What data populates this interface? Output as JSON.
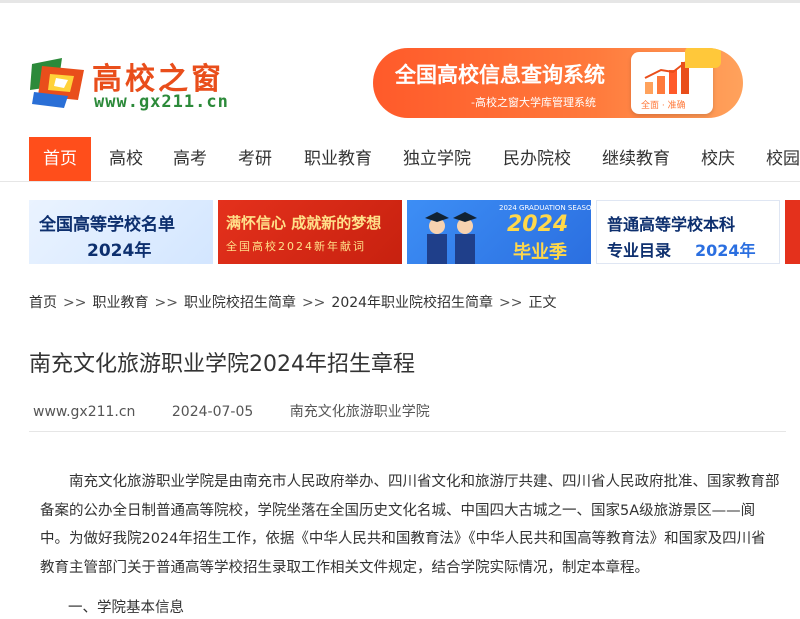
{
  "header": {
    "logo_title": "高校之窗",
    "logo_url": "www.gx211.cn",
    "banner_title": "全国高校信息查询系统",
    "banner_sub": "-高校之窗大学库管理系统",
    "banner_card_text": "全面 · 准确"
  },
  "nav": {
    "items": [
      "首页",
      "高校",
      "高考",
      "考研",
      "职业教育",
      "独立学院",
      "民办院校",
      "继续教育",
      "校庆",
      "校园"
    ]
  },
  "promos": {
    "t1_line1": "全国高等学校名单",
    "t1_line2": "2024年",
    "t2_line1": "满怀信心 成就新的梦想",
    "t2_line2": "全国高校2024新年献词",
    "t3_tag": "2024 GRADUATION SEASON",
    "t3_year": "2024",
    "t3_word": "毕业季",
    "t4_line1": "普通高等学校本科",
    "t4_line2a": "专业目录",
    "t4_line2b": "2024年"
  },
  "breadcrumb": {
    "items": [
      "首页",
      "职业教育",
      "职业院校招生简章",
      "2024年职业院校招生简章",
      "正文"
    ],
    "sep": ">>"
  },
  "article": {
    "title": "南充文化旅游职业学院2024年招生章程",
    "source": "www.gx211.cn",
    "date": "2024-07-05",
    "author": "南充文化旅游职业学院",
    "paragraph": "南充文化旅游职业学院是由南充市人民政府举办、四川省文化和旅游厅共建、四川省人民政府批准、国家教育部备案的公办全日制普通高等院校，学院坐落在全国历史文化名城、中国四大古城之一、国家5A级旅游景区——阆中。为做好我院2024年招生工作，依据《中华人民共和国教育法》《中华人民共和国高等教育法》和国家及四川省教育主管部门关于普通高等学校招生录取工作相关文件规定，结合学院实际情况，制定本章程。",
    "section1": "一、学院基本信息"
  },
  "colors": {
    "accent": "#ff4e1b",
    "logo_orange": "#e94e1b",
    "logo_green": "#2c8a3a",
    "text": "#333333"
  }
}
